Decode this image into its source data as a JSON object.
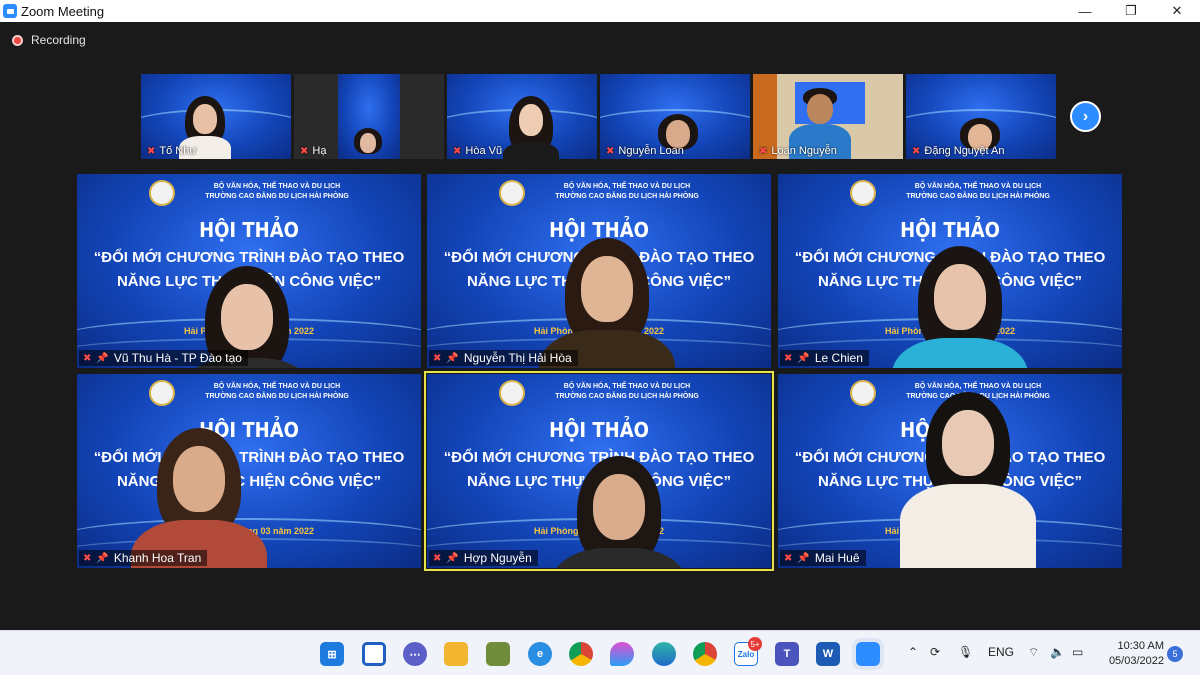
{
  "window": {
    "title": "Zoom Meeting",
    "minimize_glyph": "—",
    "restore_glyph": "❐",
    "close_glyph": "✕"
  },
  "recording": {
    "label": "Recording"
  },
  "thumbnails": [
    {
      "name": "Tố Như"
    },
    {
      "name": "Hạ"
    },
    {
      "name": "Hòa Vũ"
    },
    {
      "name": "Nguyễn Loan"
    },
    {
      "name": "Loan Nguyễn"
    },
    {
      "name": "Đặng Nguyệt An"
    }
  ],
  "next_page_glyph": "›",
  "slide": {
    "org_line1": "BỘ VĂN HÓA, THỂ THAO VÀ DU LỊCH",
    "org_line2": "TRƯỜNG CAO ĐẲNG DU LỊCH HẢI PHÒNG",
    "title": "HỘI THẢO",
    "subtitle_line1": "“ĐỔI MỚI CHƯƠNG TRÌNH ĐÀO TẠO THEO",
    "subtitle_line2": "NĂNG LỰC THỰC HIỆN CÔNG VIỆC”",
    "place_date": "Hải Phòng, tháng 03 năm 2022"
  },
  "participants": [
    {
      "name": "Vũ Thu Hà - TP Đào tạo"
    },
    {
      "name": "Nguyễn Thị Hải Hòa"
    },
    {
      "name": "Le Chien"
    },
    {
      "name": "Khanh Hoa Tran"
    },
    {
      "name": "Hợp Nguyễn",
      "active_speaker": true
    },
    {
      "name": "Mai Huê"
    }
  ],
  "icons": {
    "mic_off": "mic-off-icon",
    "pin": "pin-icon"
  },
  "taskbar": {
    "language": "ENG",
    "time": "10:30 AM",
    "date": "05/03/2022",
    "notifications": "5",
    "zalo_badge": "5+",
    "apps": [
      "start",
      "widgets",
      "teams-chat",
      "file-explorer",
      "game",
      "internet-explorer",
      "chrome",
      "paint",
      "edge",
      "chrome-profile",
      "zalo",
      "teams",
      "word",
      "zoom"
    ]
  },
  "colors": {
    "accent": "#2d8cff",
    "active_speaker_border": "#e6e34a",
    "mic_muted": "#ff4a4a"
  }
}
